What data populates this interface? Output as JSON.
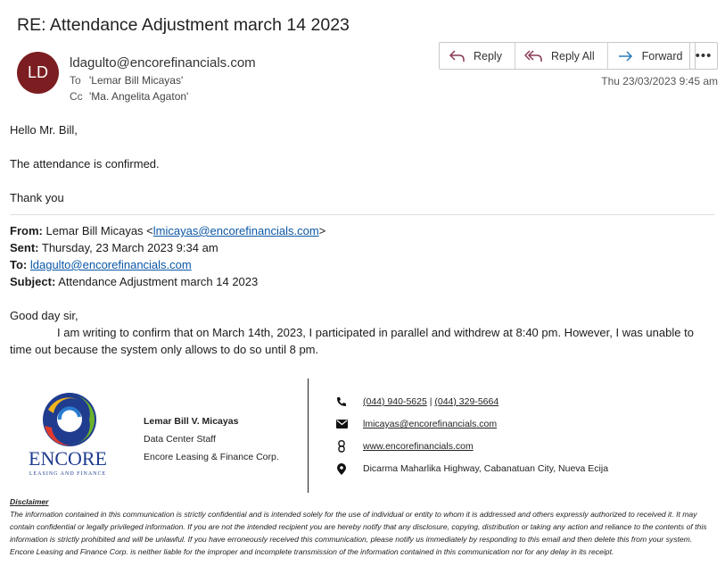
{
  "email": {
    "subject": "RE: Attendance Adjustment march 14 2023",
    "avatar_initials": "LD",
    "avatar_color": "#7b1d21",
    "sender": "ldagulto@encorefinancials.com",
    "to_label": "To",
    "to": "'Lemar Bill Micayas'",
    "cc_label": "Cc",
    "cc": "'Ma. Angelita Agaton'",
    "date": "Thu 23/03/2023 9:45 am"
  },
  "actions": {
    "reply": "Reply",
    "reply_all": "Reply All",
    "forward": "Forward",
    "more": "•••"
  },
  "reply": {
    "greeting": "Hello Mr. Bill,",
    "line1": "The attendance is confirmed.",
    "closing": "Thank you"
  },
  "quoted": {
    "from_label": "From:",
    "from_name": "Lemar Bill Micayas <",
    "from_email": "lmicayas@encorefinancials.com",
    "from_end": ">",
    "sent_label": "Sent:",
    "sent": "Thursday, 23 March 2023 9:34 am",
    "to_label": "To:",
    "to": "ldagulto@encorefinancials.com",
    "subject_label": "Subject:",
    "subject": "Attendance Adjustment march 14 2023",
    "greeting": "Good day sir,",
    "message": "I am writing to confirm that on March 14th, 2023, I participated in parallel and withdrew at 8:40 pm. However, I was unable to time out because the system only allows to do so until 8 pm."
  },
  "signature": {
    "logo_text": "ENCORE",
    "logo_sub": "LEASING AND FINANCE",
    "name": "Lemar Bill V. Micayas",
    "title": "Data Center Staff",
    "company": "Encore Leasing & Finance Corp.",
    "phone1": "(044) 940-5625",
    "phone_sep": " | ",
    "phone2": "(044) 329-5664",
    "email": "lmicayas@encorefinancials.com",
    "website": "www.encorefinancials.com",
    "address": "Dicarma Maharlika Highway, Cabanatuan City, Nueva Ecija"
  },
  "disclaimer": {
    "title": "Disclaimer",
    "text": "The information contained in this communication is strictly confidential and is intended solely for the use of individual or entity to whom it is addressed and others expressly authorized to received it. It may contain confidential or legally privileged information. If you are not the intended recipient you are hereby notify that any disclosure, copying, distribution or taking any action and reliance to the contents of this information is strictly prohibited and will be unlawful. If you have erroneously received this communication, please notify us immediately by responding to this email and then delete this from your system. Encore Leasing and Finance Corp. is neither liable for the improper and incomplete transmission of the information contained in this communication nor for any delay in its receipt."
  }
}
